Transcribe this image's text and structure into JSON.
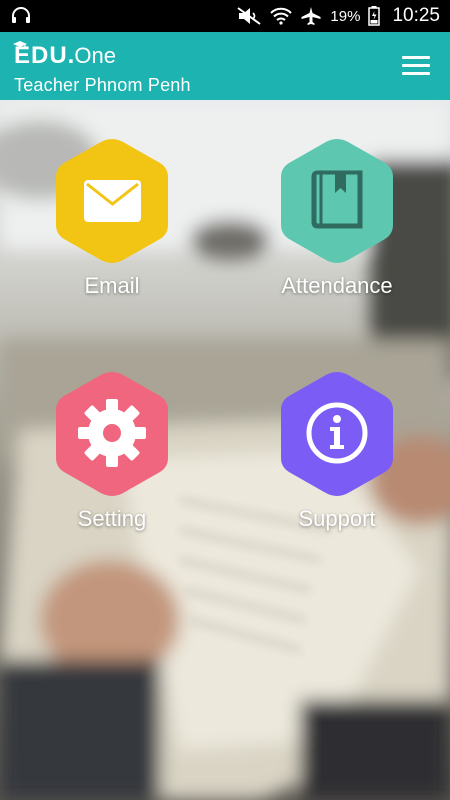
{
  "status_bar": {
    "battery_percent": "19%",
    "time": "10:25",
    "icons": [
      "headset-icon",
      "mute-icon",
      "wifi-icon",
      "airplane-icon",
      "battery-icon"
    ]
  },
  "app_bar": {
    "logo_edu": "EDU",
    "logo_dot": ".",
    "logo_one": "One",
    "subtitle": "Teacher Phnom Penh",
    "menu_icon": "hamburger-menu-icon",
    "color": "#1cb3b0"
  },
  "tiles": [
    {
      "label": "Email",
      "icon": "envelope-icon",
      "color": "#f2c414"
    },
    {
      "label": "Attendance",
      "icon": "book-icon",
      "color": "#5ec7b0"
    },
    {
      "label": "Setting",
      "icon": "gear-icon",
      "color": "#f0667e"
    },
    {
      "label": "Support",
      "icon": "info-icon",
      "color": "#7b5cf5"
    }
  ]
}
